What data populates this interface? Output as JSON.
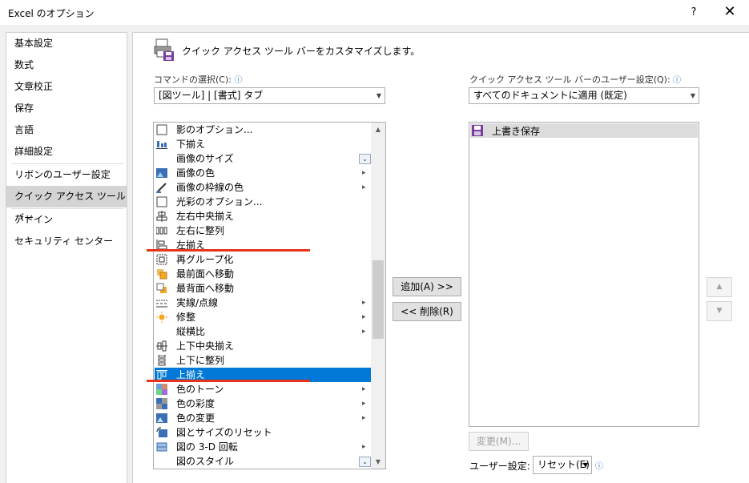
{
  "window": {
    "title": "Excel のオプション",
    "help_label": "?",
    "close_label": "✕"
  },
  "nav": {
    "items": [
      {
        "label": "基本設定"
      },
      {
        "label": "数式"
      },
      {
        "label": "文章校正"
      },
      {
        "label": "保存"
      },
      {
        "label": "言語"
      },
      {
        "label": "詳細設定"
      },
      {
        "label": "リボンのユーザー設定"
      },
      {
        "label": "クイック アクセス ツール バー"
      },
      {
        "label": "アドイン"
      },
      {
        "label": "セキュリティ センター"
      }
    ],
    "selected_index": 7
  },
  "main": {
    "header": "クイック アクセス ツール バーをカスタマイズします。",
    "choose_label": "コマンドの選択(C):",
    "choose_value": "[図ツール] | [書式] タブ",
    "customize_label": "クイック アクセス ツール バーのユーザー設定(Q):",
    "customize_value": "すべてのドキュメントに適用 (既定)",
    "commands": [
      {
        "label": "影のオプション...",
        "icon": "checkbox-icon",
        "sub": ""
      },
      {
        "label": "下揃え",
        "icon": "align-bottom-icon",
        "sub": ""
      },
      {
        "label": "画像のサイズ",
        "icon": "",
        "sub": ""
      },
      {
        "label": "画像の色",
        "icon": "picture-color-icon",
        "sub": "▸"
      },
      {
        "label": "画像の枠線の色",
        "icon": "pen-icon",
        "sub": "▸"
      },
      {
        "label": "光彩のオプション...",
        "icon": "checkbox-icon",
        "sub": ""
      },
      {
        "label": "左右中央揃え",
        "icon": "align-center-icon",
        "sub": ""
      },
      {
        "label": "左右に整列",
        "icon": "distribute-horizontal-icon",
        "sub": ""
      },
      {
        "label": "左揃え",
        "icon": "align-left-icon",
        "sub": ""
      },
      {
        "label": "再グループ化",
        "icon": "regroup-icon",
        "sub": ""
      },
      {
        "label": "最前面へ移動",
        "icon": "bring-front-icon",
        "sub": ""
      },
      {
        "label": "最背面へ移動",
        "icon": "send-back-icon",
        "sub": ""
      },
      {
        "label": "実線/点線",
        "icon": "dash-icon",
        "sub": "▸"
      },
      {
        "label": "修整",
        "icon": "sun-icon",
        "sub": "▸"
      },
      {
        "label": "縦横比",
        "icon": "",
        "sub": "▸"
      },
      {
        "label": "上下中央揃え",
        "icon": "align-middle-icon",
        "sub": ""
      },
      {
        "label": "上下に整列",
        "icon": "distribute-vertical-icon",
        "sub": ""
      },
      {
        "label": "上揃え",
        "icon": "align-top-icon",
        "sub": ""
      },
      {
        "label": "色のトーン",
        "icon": "color-tone-icon",
        "sub": "▸"
      },
      {
        "label": "色の彩度",
        "icon": "saturation-icon",
        "sub": "▸"
      },
      {
        "label": "色の変更",
        "icon": "recolor-icon",
        "sub": "▸"
      },
      {
        "label": "図とサイズのリセット",
        "icon": "reset-picture-icon",
        "sub": ""
      },
      {
        "label": "図の 3-D 回転",
        "icon": "rotate-3d-icon",
        "sub": "▸"
      },
      {
        "label": "図のスタイル",
        "icon": "",
        "sub": ""
      }
    ],
    "selected_command_index": 17,
    "add_button": "追加(A) >>",
    "remove_button": "<< 削除(R)",
    "qat_items": [
      {
        "label": "上書き保存",
        "icon": "save-icon"
      }
    ],
    "modify_button": "変更(M)...",
    "user_settings_label": "ユーザー設定:",
    "reset_button": "リセット(E)",
    "move_up": "▲",
    "move_down": "▼",
    "expander_glyph": "⌄",
    "scroll_up": "▲",
    "scroll_down": "▼",
    "info_glyph": "ⓘ"
  },
  "colors": {
    "selection": "#0078d7",
    "highlight_line": "#e8331c",
    "nav_selected": "#d4d4d4"
  }
}
